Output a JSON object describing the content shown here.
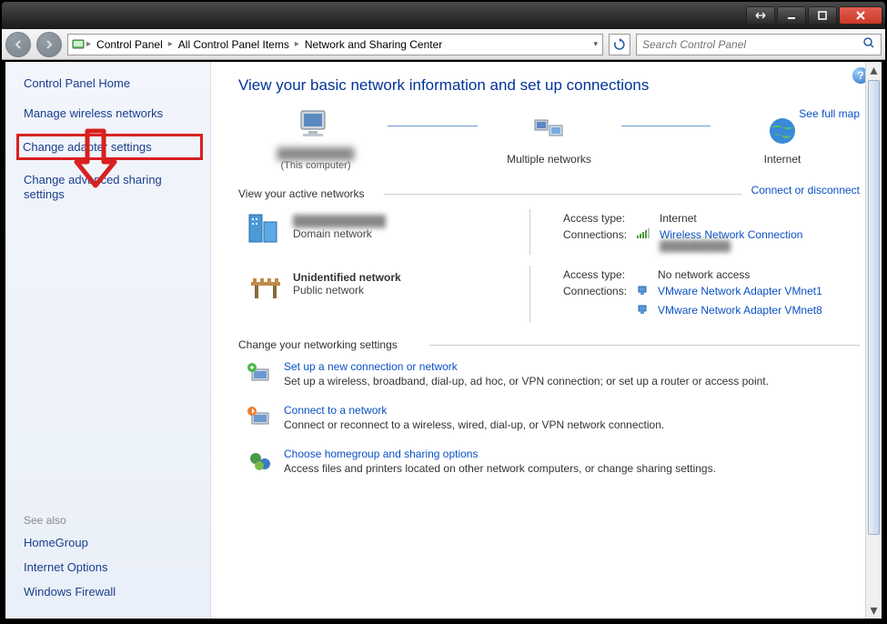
{
  "titlebar": {
    "tooltip_min": "Minimize",
    "tooltip_max": "Maximize",
    "tooltip_close": "Close"
  },
  "breadcrumb": {
    "items": [
      "Control Panel",
      "All Control Panel Items",
      "Network and Sharing Center"
    ]
  },
  "search": {
    "placeholder": "Search Control Panel"
  },
  "sidebar": {
    "home": "Control Panel Home",
    "items": [
      {
        "label": "Manage wireless networks"
      },
      {
        "label": "Change adapter settings",
        "highlighted": true
      },
      {
        "label": "Change advanced sharing settings"
      }
    ],
    "see_also_title": "See also",
    "see_also": [
      {
        "label": "HomeGroup"
      },
      {
        "label": "Internet Options"
      },
      {
        "label": "Windows Firewall"
      }
    ]
  },
  "main": {
    "title": "View your basic network information and set up connections",
    "see_full_map": "See full map",
    "diagram": {
      "this_computer_caption": "(This computer)",
      "multiple_networks": "Multiple networks",
      "internet": "Internet"
    },
    "active_networks": {
      "heading": "View your active networks",
      "connect_disconnect": "Connect or disconnect",
      "labels": {
        "access_type": "Access type:",
        "connections": "Connections:"
      },
      "networks": [
        {
          "name_blurred": true,
          "type": "Domain network",
          "access_type": "Internet",
          "connections": [
            {
              "label": "Wireless Network Connection",
              "icon": "signal"
            }
          ]
        },
        {
          "name": "Unidentified network",
          "name_blurred": false,
          "type": "Public network",
          "access_type": "No network access",
          "connections": [
            {
              "label": "VMware Network Adapter VMnet1",
              "icon": "cable"
            },
            {
              "label": "VMware Network Adapter VMnet8",
              "icon": "cable"
            }
          ]
        }
      ]
    },
    "change_settings": {
      "heading": "Change your networking settings",
      "items": [
        {
          "link": "Set up a new connection or network",
          "desc": "Set up a wireless, broadband, dial-up, ad hoc, or VPN connection; or set up a router or access point."
        },
        {
          "link": "Connect to a network",
          "desc": "Connect or reconnect to a wireless, wired, dial-up, or VPN network connection."
        },
        {
          "link": "Choose homegroup and sharing options",
          "desc": "Access files and printers located on other network computers, or change sharing settings."
        }
      ]
    }
  }
}
